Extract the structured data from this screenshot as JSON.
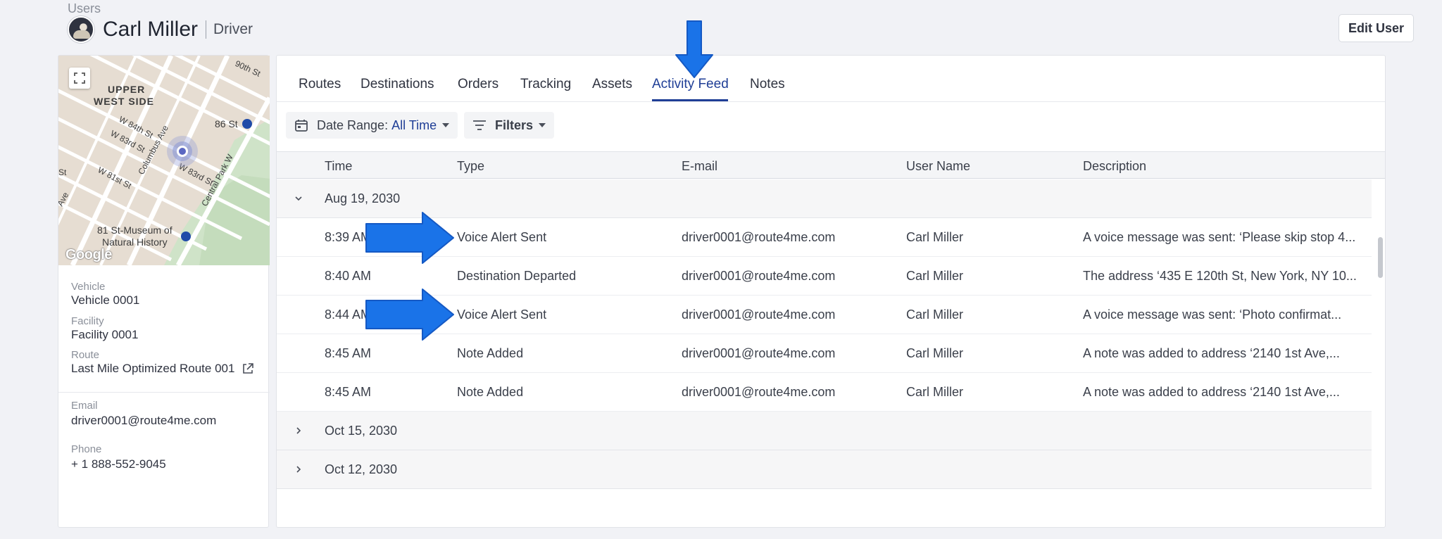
{
  "breadcrumb": "Users",
  "header": {
    "name": "Carl Miller",
    "role": "Driver",
    "edit_button": "Edit User"
  },
  "map": {
    "neighborhood_line1": "UPPER",
    "neighborhood_line2": "WEST SIDE",
    "streets": [
      "90th St",
      "W 84th St",
      "W 83rd St",
      "Columbus Ave",
      "W 83rd St",
      "W 81st St",
      "Central Park W",
      "St",
      "Ave"
    ],
    "station_86": "86 St",
    "museum_line1": "81 St-Museum of",
    "museum_line2": "Natural History",
    "logo": "Google",
    "icon_expand": "expand-icon"
  },
  "details": {
    "vehicle_label": "Vehicle",
    "vehicle_value": "Vehicle 0001",
    "facility_label": "Facility",
    "facility_value": "Facility 0001",
    "route_label": "Route",
    "route_value": "Last Mile Optimized Route 001",
    "email_label": "Email",
    "email_value": "driver0001@route4me.com",
    "phone_label": "Phone",
    "phone_value": "+ 1 888-552-9045"
  },
  "tabs": [
    "Routes",
    "Destinations",
    "Orders",
    "Tracking",
    "Assets",
    "Activity Feed",
    "Notes"
  ],
  "active_tab": "Activity Feed",
  "toolbar": {
    "date_range_label": "Date Range:",
    "date_range_value": "All Time",
    "filters_label": "Filters"
  },
  "columns": [
    "Time",
    "Type",
    "E-mail",
    "User Name",
    "Description"
  ],
  "groups": [
    {
      "date": "Aug 19, 2030",
      "expanded": true,
      "rows": [
        {
          "time": "8:39 AM",
          "type": "Voice Alert Sent",
          "email": "driver0001@route4me.com",
          "user": "Carl Miller",
          "description": "A voice message was sent: ‘Please skip stop 4..."
        },
        {
          "time": "8:40 AM",
          "type": "Destination Departed",
          "email": "driver0001@route4me.com",
          "user": "Carl Miller",
          "description": "The address ‘435 E 120th St, New York, NY 10..."
        },
        {
          "time": "8:44 AM",
          "type": "Voice Alert Sent",
          "email": "driver0001@route4me.com",
          "user": "Carl Miller",
          "description": "A  voice message was sent: ‘Photo confirmat..."
        },
        {
          "time": "8:45 AM",
          "type": "Note Added",
          "email": "driver0001@route4me.com",
          "user": "Carl Miller",
          "description": "A note was added to address ‘2140 1st Ave,..."
        },
        {
          "time": "8:45 AM",
          "type": "Note Added",
          "email": "driver0001@route4me.com",
          "user": "Carl Miller",
          "description": "A note was added to address ‘2140 1st Ave,..."
        }
      ]
    },
    {
      "date": "Oct 15, 2030",
      "expanded": false
    },
    {
      "date": "Oct 12, 2030",
      "expanded": false
    }
  ],
  "colors": {
    "accent": "#1f3e96",
    "annotation_arrow": "#1a73e8"
  }
}
